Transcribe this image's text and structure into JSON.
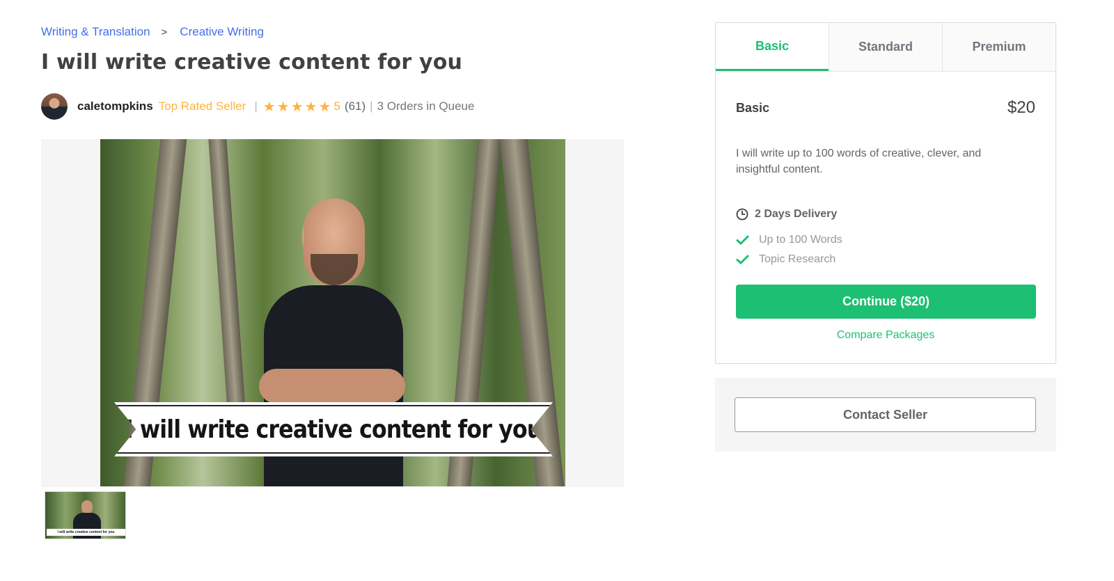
{
  "breadcrumb": {
    "items": [
      "Writing & Translation",
      "Creative Writing"
    ],
    "separator": ">"
  },
  "gig": {
    "title": "I will write creative content for you",
    "banner_text": "I will write creative content for you"
  },
  "seller": {
    "username": "caletompkins",
    "level": "Top Rated Seller",
    "rating": "5",
    "stars": 5,
    "review_count": "(61)",
    "orders_in_queue": "3 Orders in Queue",
    "separator": "|"
  },
  "star_glyph": "★",
  "packages": {
    "tabs": [
      "Basic",
      "Standard",
      "Premium"
    ],
    "active_tab": "Basic",
    "selected": {
      "name": "Basic",
      "price": "$20",
      "description": "I will write up to 100 words of creative, clever, and insightful content.",
      "delivery": "2 Days Delivery",
      "features": [
        "Up to 100 Words",
        "Topic Research"
      ]
    },
    "continue_label": "Continue ($20)",
    "compare_label": "Compare Packages"
  },
  "contact": {
    "label": "Contact Seller"
  },
  "colors": {
    "brand_green": "#1dbf73",
    "link_blue": "#446ee7",
    "star_gold": "#ffb33e"
  },
  "icons": {
    "breadcrumb_separator": "chevron-right-icon",
    "delivery": "clock-icon",
    "feature": "check-icon",
    "rating": "star-icon"
  }
}
